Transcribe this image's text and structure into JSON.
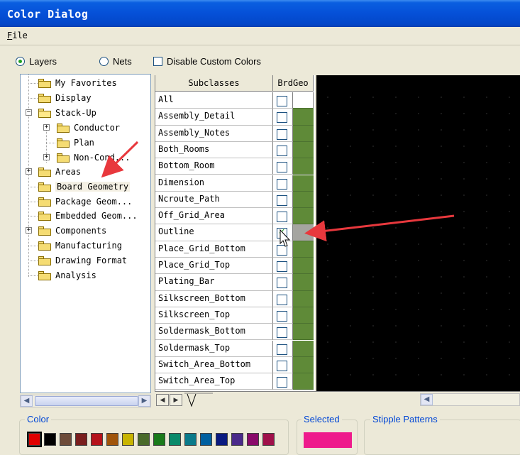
{
  "window": {
    "title": "Color Dialog"
  },
  "menu": {
    "file": "File"
  },
  "options": {
    "layers_label": "Layers",
    "layers_selected": true,
    "nets_label": "Nets",
    "nets_selected": false,
    "disable_custom_label": "Disable Custom Colors",
    "disable_custom_checked": false
  },
  "tree": {
    "items": [
      {
        "label": "My Favorites"
      },
      {
        "label": "Display"
      },
      {
        "label": "Stack-Up"
      },
      {
        "label": "Conductor"
      },
      {
        "label": "Plan"
      },
      {
        "label": "Non-Cond..."
      },
      {
        "label": "Areas"
      },
      {
        "label": "Board Geometry"
      },
      {
        "label": "Package Geom..."
      },
      {
        "label": "Embedded Geom..."
      },
      {
        "label": "Components"
      },
      {
        "label": "Manufacturing"
      },
      {
        "label": "Drawing Format"
      },
      {
        "label": "Analysis"
      }
    ]
  },
  "grid": {
    "col_subclasses": "Subclasses",
    "col_brdgeo": "BrdGeo",
    "rows": [
      {
        "name": "All",
        "checked": false
      },
      {
        "name": "Assembly_Detail",
        "checked": false
      },
      {
        "name": "Assembly_Notes",
        "checked": false
      },
      {
        "name": "Both_Rooms",
        "checked": false
      },
      {
        "name": "Bottom_Room",
        "checked": false
      },
      {
        "name": "Dimension",
        "checked": false
      },
      {
        "name": "Ncroute_Path",
        "checked": false
      },
      {
        "name": "Off_Grid_Area",
        "checked": false
      },
      {
        "name": "Outline",
        "checked": true
      },
      {
        "name": "Place_Grid_Bottom",
        "checked": false
      },
      {
        "name": "Place_Grid_Top",
        "checked": false
      },
      {
        "name": "Plating_Bar",
        "checked": false
      },
      {
        "name": "Silkscreen_Bottom",
        "checked": false
      },
      {
        "name": "Silkscreen_Top",
        "checked": false
      },
      {
        "name": "Soldermask_Bottom",
        "checked": false
      },
      {
        "name": "Soldermask_Top",
        "checked": false
      },
      {
        "name": "Switch_Area_Bottom",
        "checked": false
      },
      {
        "name": "Switch_Area_Top",
        "checked": false
      }
    ],
    "color_green": "#5f8a38",
    "color_highlight": "#a5a5a0"
  },
  "bottom": {
    "color_label": "Color",
    "selected_label": "Selected",
    "stipple_label": "Stipple Patterns",
    "selected_color": "#ee1b8c",
    "palette": [
      "#e00000",
      "#000000",
      "#6e4c3a",
      "#7a1e1e",
      "#b5121b",
      "#a0540a",
      "#c8b400",
      "#4a6a2a",
      "#1a7a1a",
      "#0a8a6a",
      "#0a7a8a",
      "#0060a0",
      "#0a1a80",
      "#4a2a8a",
      "#8a0a6a",
      "#a0104a"
    ]
  }
}
